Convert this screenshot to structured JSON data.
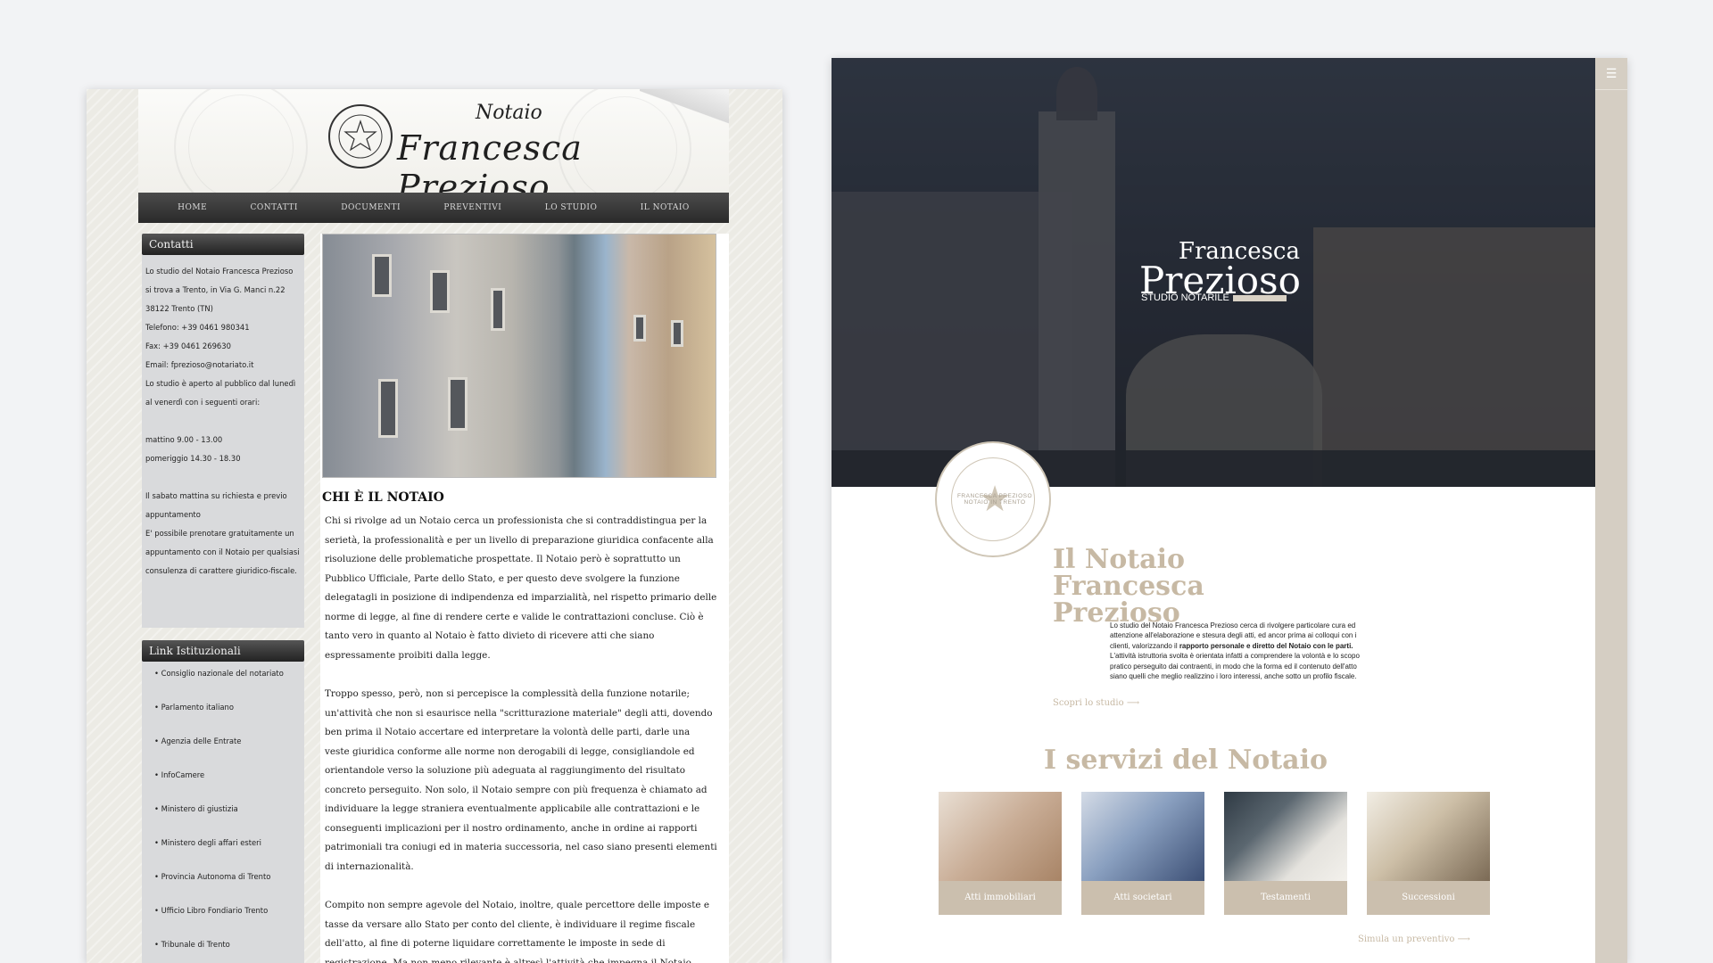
{
  "old_site": {
    "header": {
      "notaio": "Notaio",
      "name": "Francesca Prezioso"
    },
    "nav": [
      {
        "label": "HOME"
      },
      {
        "label": "CONTATTI"
      },
      {
        "label": "DOCUMENTI"
      },
      {
        "label": "PREVENTIVI"
      },
      {
        "label": "LO STUDIO"
      },
      {
        "label": "IL NOTAIO"
      }
    ],
    "contatti": {
      "title": "Contatti",
      "lines": [
        "Lo studio del Notaio Francesca Prezioso si trova a Trento, in Via G. Manci n.22",
        "38122 Trento (TN)",
        "Telefono: +39 0461 980341",
        "Fax: +39 0461 269630",
        "Email: fprezioso@notariato.it",
        "Lo studio è aperto al pubblico dal lunedì al venerdì con i seguenti orari:",
        "",
        "mattino 9.00 - 13.00",
        "pomeriggio 14.30 - 18.30",
        "",
        "Il sabato mattina su richiesta e previo appuntamento",
        "E' possibile prenotare gratuitamente un appuntamento con il Notaio per qualsiasi consulenza di carattere giuridico-fiscale."
      ]
    },
    "links": {
      "title": "Link Istituzionali",
      "items": [
        "Consiglio nazionale del notariato",
        "Parlamento italiano",
        "Agenzia delle Entrate",
        "InfoCamere",
        "Ministero di giustizia",
        "Ministero degli affari esteri",
        "Provincia Autonoma di Trento",
        "Ufficio Libro Fondiario Trento",
        "Tribunale di Trento"
      ]
    },
    "main": {
      "heading": "CHI È IL NOTAIO",
      "paragraphs": [
        "Chi si rivolge ad un Notaio cerca un professionista che si contraddistingua per la serietà, la professionalità e per un livello di preparazione giuridica confacente alla risoluzione delle problematiche prospettate. Il Notaio però è soprattutto un Pubblico Ufficiale, Parte dello Stato, e per questo deve svolgere la funzione delegatagli in posizione di indipendenza ed imparzialità, nel rispetto primario delle norme di legge, al fine di rendere certe e valide le contrattazioni concluse. Ciò è tanto vero in quanto al Notaio è fatto divieto di ricevere atti che siano espressamente proibiti dalla legge.",
        "Troppo spesso, però, non si percepisce la complessità della funzione notarile; un'attività che non si esaurisce nella \"scritturazione materiale\" degli atti, dovendo ben prima il Notaio accertare ed interpretare la volontà delle parti, darle una veste giuridica conforme alle norme non derogabili di legge, consigliandole ed orientandole verso la soluzione più adeguata al raggiungimento del risultato concreto perseguito. Non solo, il Notaio sempre con più frequenza è chiamato ad individuare la legge straniera eventualmente applicabile alle contrattazioni e le conseguenti implicazioni per il nostro ordinamento, anche in ordine ai rapporti patrimoniali tra coniugi ed in materia successoria, nel caso siano presenti elementi di internazionalità.",
        "Compito non sempre agevole del Notaio, inoltre, quale percettore delle imposte e tasse da versare allo Stato per conto del cliente, è individuare il regime fiscale dell'atto, al fine di poterne liquidare correttamente le imposte in sede di registrazione. Ma non meno rilevante è altresì l'attività che impegna il Notaio"
      ]
    }
  },
  "new_site": {
    "menu_icon": "☰",
    "hero": {
      "first": "Francesca",
      "last": "Prezioso",
      "subtitle": "STUDIO NOTARILE"
    },
    "seal_text": "FRANCESCA PREZIOSO NOTAIO IN TRENTO",
    "about": {
      "title": "Il Notaio Francesca Prezioso",
      "text_before": "Lo studio del Notaio Francesca Prezioso cerca di rivolgere particolare cura ed attenzione all'elaborazione e stesura degli atti, ed ancor prima ai colloqui con i clienti, valorizzando il ",
      "text_bold": "rapporto personale e diretto del Notaio con le parti.",
      "text_after": " L'attività istruttoria svolta è orientata infatti a comprendere la volontà e lo scopo pratico perseguito dai contraenti, in modo che la forma ed il contenuto dell'atto siano quelli che meglio realizzino i loro interessi, anche sotto un profilo fiscale.",
      "link": "Scopri lo studio ⟶"
    },
    "services": {
      "title": "I servizi del Notaio",
      "items": [
        {
          "label": "Atti immobiliari"
        },
        {
          "label": "Atti societari"
        },
        {
          "label": "Testamenti"
        },
        {
          "label": "Successioni"
        }
      ],
      "link": "Simula un preventivo ⟶"
    }
  }
}
